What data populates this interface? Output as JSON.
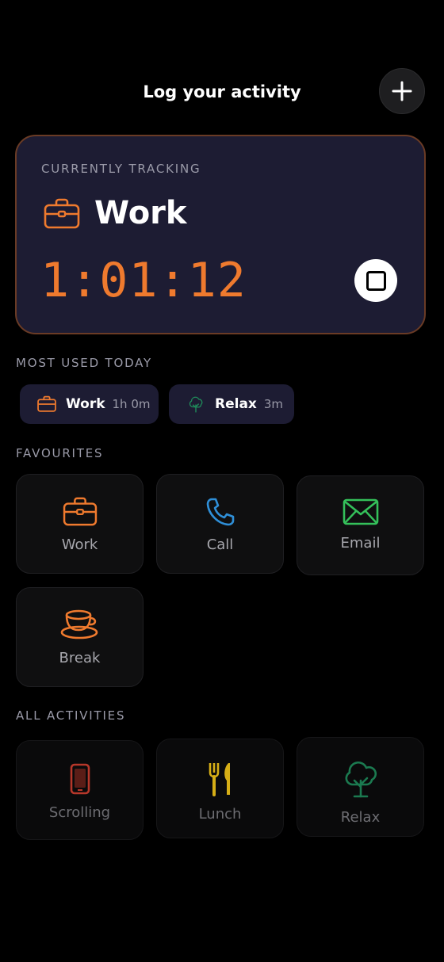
{
  "header": {
    "title": "Log your activity",
    "add_icon": "plus-icon"
  },
  "tracking": {
    "label": "CURRENTLY TRACKING",
    "activity": "Work",
    "icon": "briefcase-icon",
    "timer": "1:01:12",
    "stop_icon": "stop-icon",
    "accent_color": "#ef7a2e"
  },
  "most_used": {
    "label": "MOST USED TODAY",
    "items": [
      {
        "name": "Work",
        "time": "1h 0m",
        "icon": "briefcase-icon"
      },
      {
        "name": "Relax",
        "time": "3m",
        "icon": "tree-icon"
      }
    ]
  },
  "favourites": {
    "label": "FAVOURITES",
    "items": [
      {
        "name": "Work",
        "icon": "briefcase-icon",
        "color": "#ef7a2e"
      },
      {
        "name": "Call",
        "icon": "phone-icon",
        "color": "#2f8fd8"
      },
      {
        "name": "Email",
        "icon": "envelope-icon",
        "color": "#34c05a"
      },
      {
        "name": "Break",
        "icon": "coffee-cup-icon",
        "color": "#ef7a2e"
      }
    ]
  },
  "all_activities": {
    "label": "ALL ACTIVITIES",
    "items": [
      {
        "name": "Scrolling",
        "icon": "smartphone-icon",
        "color": "#d9412f"
      },
      {
        "name": "Lunch",
        "icon": "fork-knife-icon",
        "color": "#f0c419"
      },
      {
        "name": "Relax",
        "icon": "tree-icon",
        "color": "#1f8a5a"
      }
    ]
  }
}
